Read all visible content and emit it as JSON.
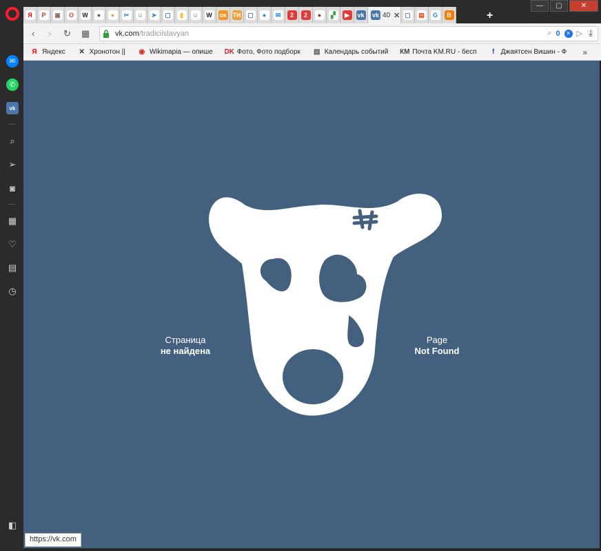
{
  "browser": {
    "tabs_favicons": [
      {
        "icon": "yandex-icon",
        "glyph": "Я",
        "color": "#ff0000",
        "bg": "#ffffff"
      },
      {
        "icon": "pdf-icon",
        "glyph": "P",
        "color": "#d32f2f",
        "bg": "#ffffff"
      },
      {
        "icon": "portrait-icon",
        "glyph": "▣",
        "color": "#8d6e63",
        "bg": "#ffffff"
      },
      {
        "icon": "opera-icon",
        "glyph": "O",
        "color": "#e53935",
        "bg": "#ffffff"
      },
      {
        "icon": "wiki-icon",
        "glyph": "W",
        "color": "#222222",
        "bg": "#ffffff"
      },
      {
        "icon": "green-circle-icon",
        "glyph": "●",
        "color": "#2e7d32",
        "bg": "#ffffff"
      },
      {
        "icon": "orange-circle-icon",
        "glyph": "●",
        "color": "#f0a030",
        "bg": "#ffffff"
      },
      {
        "icon": "scissors-icon",
        "glyph": "✂",
        "color": "#1e88e5",
        "bg": "#ffffff"
      },
      {
        "icon": "person-icon",
        "glyph": "☺",
        "color": "#4a76a8",
        "bg": "#ffffff"
      },
      {
        "icon": "arrow-icon",
        "glyph": "➤",
        "color": "#1e88e5",
        "bg": "#ffffff"
      },
      {
        "icon": "chat-icon",
        "glyph": "▢",
        "color": "#4a76a8",
        "bg": "#ffffff"
      },
      {
        "icon": "flag-icon",
        "glyph": "▮",
        "color": "#fbc02d",
        "bg": "#ffffff"
      },
      {
        "icon": "person-icon",
        "glyph": "☺",
        "color": "#4a76a8",
        "bg": "#ffffff"
      },
      {
        "icon": "wiki-icon",
        "glyph": "W",
        "color": "#222222",
        "bg": "#ffffff"
      },
      {
        "icon": "ok-icon",
        "glyph": "ок",
        "color": "#ffffff",
        "bg": "#f7931e"
      },
      {
        "icon": "ti-icon",
        "glyph": "ТИ",
        "color": "#ffffff",
        "bg": "#f0a030"
      },
      {
        "icon": "chat-icon",
        "glyph": "▢",
        "color": "#4a76a8",
        "bg": "#ffffff"
      },
      {
        "icon": "drop-icon",
        "glyph": "●",
        "color": "#1e88e5",
        "bg": "#ffffff"
      },
      {
        "icon": "mail-icon",
        "glyph": "✉",
        "color": "#1e88e5",
        "bg": "#ffffff"
      },
      {
        "icon": "red-2-icon",
        "glyph": "2",
        "color": "#ffffff",
        "bg": "#e53935"
      },
      {
        "icon": "red-2-icon",
        "glyph": "2",
        "color": "#ffffff",
        "bg": "#e53935"
      },
      {
        "icon": "ball-icon",
        "glyph": "●",
        "color": "#8d3b2b",
        "bg": "#ffffff"
      },
      {
        "icon": "rainbow-icon",
        "glyph": "▞",
        "color": "#43a047",
        "bg": "#ffffff"
      },
      {
        "icon": "youtube-icon",
        "glyph": "▶",
        "color": "#ffffff",
        "bg": "#e53935"
      },
      {
        "icon": "vk-icon",
        "glyph": "vk",
        "color": "#ffffff",
        "bg": "#4a76a8"
      }
    ],
    "active_tab": {
      "title": "40",
      "icon": "vk-icon",
      "glyph": "vk"
    },
    "tabs_after": [
      {
        "icon": "chat-icon",
        "glyph": "▢",
        "color": "#4a76a8",
        "bg": "#ffffff"
      },
      {
        "icon": "news-icon",
        "glyph": "▤",
        "color": "#e64a19",
        "bg": "#ffffff"
      },
      {
        "icon": "translate-icon",
        "glyph": "G",
        "color": "#1e88e5",
        "bg": "#ffffff"
      },
      {
        "icon": "blogger-icon",
        "glyph": "B",
        "color": "#ffffff",
        "bg": "#f57c00"
      }
    ],
    "address": {
      "host": "vk.com",
      "path": "/tradiciislavyan",
      "adblock_count": "0"
    },
    "bookmarks": [
      {
        "label": "Яндекс",
        "icon": "yandex-icon",
        "glyph": "Я",
        "color": "#ff0000"
      },
      {
        "label": "Хронотон ||",
        "icon": "chronoton-icon",
        "glyph": "✕",
        "color": "#333333"
      },
      {
        "label": "Wikimapia — опише",
        "icon": "wikimapia-icon",
        "glyph": "◉",
        "color": "#d32f2f"
      },
      {
        "label": "Фото, Фото подборк",
        "icon": "dk-icon",
        "glyph": "DK",
        "color": "#c62828"
      },
      {
        "label": "Календарь событий",
        "icon": "page-icon",
        "glyph": "▤",
        "color": "#555555"
      },
      {
        "label": "Почта KM.RU - бесп",
        "icon": "km-icon",
        "glyph": "КМ",
        "color": "#444444"
      },
      {
        "label": "Джаятсен Вишин - Ф",
        "icon": "facebook-icon",
        "glyph": "f",
        "color": "#3b5998"
      }
    ],
    "status_url": "https://vk.com"
  },
  "page": {
    "bg_color": "#44607f",
    "message_ru_line1": "Страница",
    "message_ru_line2": "не найдена",
    "message_en_line1": "Page",
    "message_en_line2": "Not Found"
  }
}
